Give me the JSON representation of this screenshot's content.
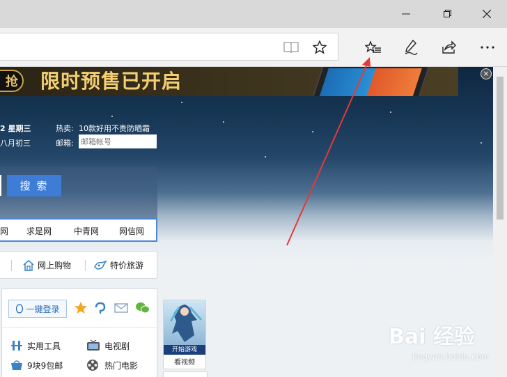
{
  "browser": {
    "window_controls": {
      "minimize": "minimize-icon",
      "maximize": "maximize-icon",
      "close": "close-icon"
    },
    "toolbar_icons": [
      "reading-view-icon",
      "favorite-star-icon",
      "favorites-hub-icon",
      "web-note-pen-icon",
      "share-icon",
      "more-dots-icon"
    ]
  },
  "banner": {
    "badge": "抢",
    "text": "限时预售已开启",
    "close_glyph": "×"
  },
  "date_info": {
    "date": "2 星期三",
    "lunar": "八月初三"
  },
  "hot": {
    "label": "热卖:",
    "text": "10款好用不贵防晒霜"
  },
  "mail": {
    "label": "邮箱:",
    "placeholder": "邮箱帐号"
  },
  "search": {
    "button": "搜 索"
  },
  "site_links": [
    "网",
    "求是网",
    "中青网",
    "网信网"
  ],
  "shop_links": [
    {
      "label": "网上购物",
      "icon": "shop-icon"
    },
    {
      "label": "特价旅游",
      "icon": "travel-icon"
    }
  ],
  "login": {
    "button": "一键登录",
    "icons": [
      "star-icon",
      "pinwheel-icon",
      "mail-icon",
      "wechat-icon"
    ]
  },
  "tools": [
    {
      "label": "实用工具",
      "icon": "tools-icon"
    },
    {
      "label": "电视剧",
      "icon": "tv-icon"
    },
    {
      "label": "9块9包邮",
      "icon": "basket-icon"
    },
    {
      "label": "热门电影",
      "icon": "film-icon"
    }
  ],
  "game": {
    "caption": "开始游戏",
    "sub": "看视频"
  },
  "watermark": {
    "text": "Bai 经验",
    "sub": "jingyan.baidu.com"
  },
  "colors": {
    "search_blue": "#3f7cd6",
    "banner_gold": "#f3cf72",
    "annotation_red": "#e53935"
  }
}
